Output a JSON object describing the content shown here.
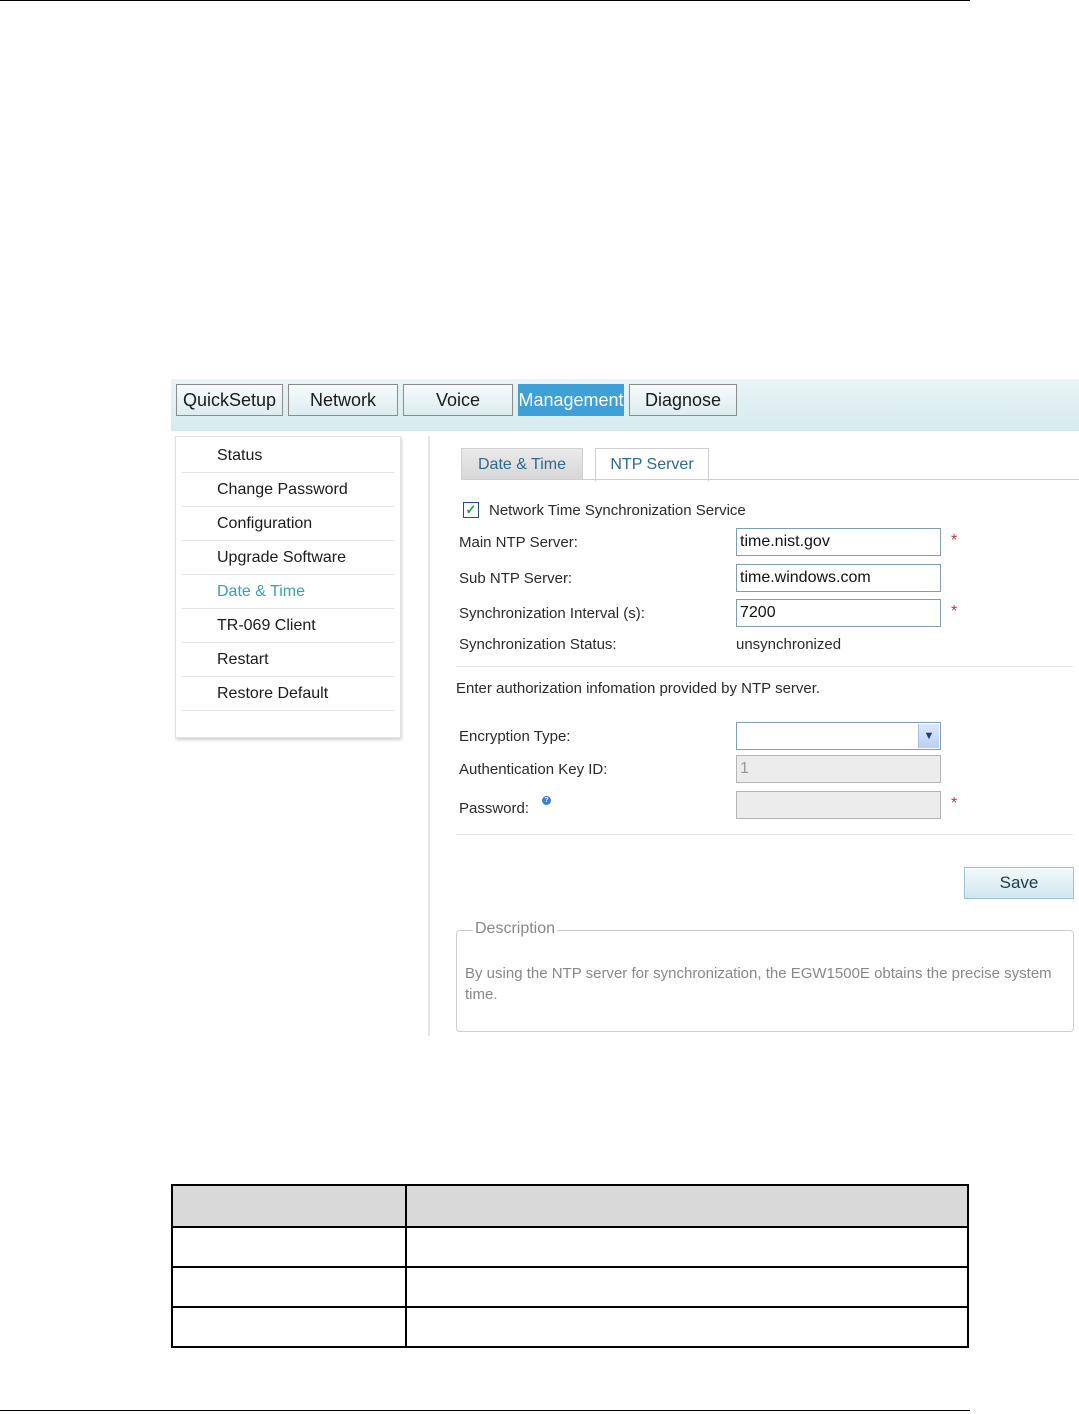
{
  "top_nav": {
    "tabs": [
      {
        "label": "QuickSetup",
        "active": false
      },
      {
        "label": "Network",
        "active": false
      },
      {
        "label": "Voice",
        "active": false
      },
      {
        "label": "Management",
        "active": true
      },
      {
        "label": "Diagnose",
        "active": false
      }
    ]
  },
  "sidebar": {
    "items": [
      {
        "label": "Status",
        "active": false
      },
      {
        "label": "Change Password",
        "active": false
      },
      {
        "label": "Configuration",
        "active": false
      },
      {
        "label": "Upgrade Software",
        "active": false
      },
      {
        "label": "Date & Time",
        "active": true
      },
      {
        "label": "TR-069 Client",
        "active": false
      },
      {
        "label": "Restart",
        "active": false
      },
      {
        "label": "Restore Default",
        "active": false
      }
    ]
  },
  "content_tabs": {
    "date_time": "Date & Time",
    "ntp_server": "NTP Server",
    "active": "NTP Server"
  },
  "form": {
    "sync_service": {
      "label": "Network Time Synchronization Service",
      "checked": true
    },
    "main_ntp": {
      "label": "Main NTP Server:",
      "value": "time.nist.gov",
      "required": "*"
    },
    "sub_ntp": {
      "label": "Sub NTP Server:",
      "value": "time.windows.com"
    },
    "interval": {
      "label": "Synchronization Interval (s):",
      "value": "7200",
      "required": "*"
    },
    "sync_status": {
      "label": "Synchronization Status:",
      "value": "unsynchronized"
    },
    "auth_info": "Enter authorization infomation provided by NTP server.",
    "encryption": {
      "label": "Encryption Type:",
      "value": ""
    },
    "auth_key_id": {
      "label": "Authentication Key ID:",
      "value": "1"
    },
    "password": {
      "label": "Password:",
      "value": "",
      "required": "*"
    },
    "save_label": "Save"
  },
  "description": {
    "legend": "Description",
    "text": "By using the NTP server for synchronization, the EGW1500E obtains the precise system time."
  },
  "colors": {
    "active_tab_bg": "#3f9fd7",
    "active_sidebar_text": "#3aa0b5",
    "required_marker": "#d9302a",
    "checkbox_mark": "#2e9d39"
  },
  "icons": [
    "checkbox-check-icon",
    "chevron-down-icon",
    "help-icon"
  ]
}
